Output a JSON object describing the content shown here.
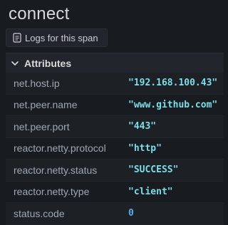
{
  "span": {
    "title": "connect",
    "logs_button": "Logs for this span"
  },
  "attributes": {
    "header": "Attributes",
    "rows": [
      {
        "key": "net.host.ip",
        "value": "\"192.168.100.43\""
      },
      {
        "key": "net.peer.name",
        "value": "\"www.github.com\""
      },
      {
        "key": "net.peer.port",
        "value": "\"443\""
      },
      {
        "key": "reactor.netty.protocol",
        "value": "\"http\""
      },
      {
        "key": "reactor.netty.status",
        "value": "\"SUCCESS\""
      },
      {
        "key": "reactor.netty.type",
        "value": "\"client\""
      },
      {
        "key": "status.code",
        "value": "0"
      }
    ]
  },
  "colors": {
    "background": "#181b1f",
    "string_value": "#7ddde8",
    "number_value": "#5aa9f0",
    "key_text": "#9fa7b3"
  }
}
